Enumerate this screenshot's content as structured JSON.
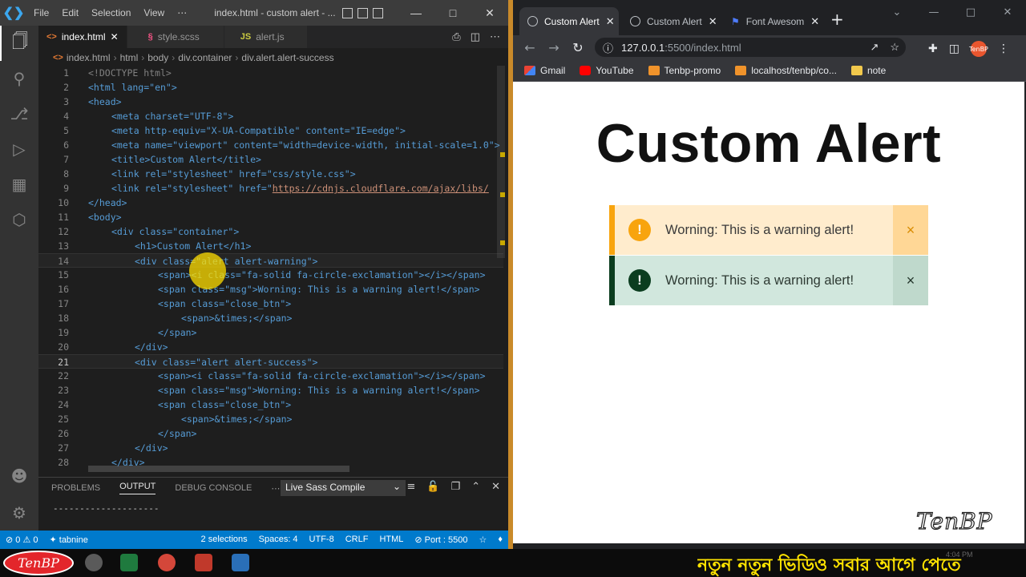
{
  "vscode": {
    "menu": [
      "File",
      "Edit",
      "Selection",
      "View",
      "⋯"
    ],
    "title": "index.html - custom alert - ...",
    "window_controls": [
      "—",
      "□",
      "✕"
    ],
    "tabs": [
      {
        "label": "index.html",
        "icon": "<>",
        "close": "✕"
      },
      {
        "label": "style.scss",
        "icon": "§"
      },
      {
        "label": "alert.js",
        "icon": "JS"
      }
    ],
    "breadcrumb": [
      "index.html",
      "html",
      "body",
      "div.container",
      "div.alert.alert-success"
    ],
    "line_numbers": [
      "1",
      "2",
      "3",
      "4",
      "5",
      "6",
      "7",
      "8",
      "9",
      "10",
      "11",
      "12",
      "13",
      "14",
      "15",
      "16",
      "17",
      "18",
      "19",
      "20",
      "21",
      "22",
      "23",
      "24",
      "25",
      "26",
      "27",
      "28"
    ],
    "code": {
      "l1": "<!DOCTYPE html>",
      "l2": "<html lang=\"en\">",
      "l3": "<head>",
      "l4": "<meta charset=\"UTF-8\">",
      "l5": "<meta http-equiv=\"X-UA-Compatible\" content=\"IE=edge\">",
      "l6": "<meta name=\"viewport\" content=\"width=device-width, initial-scale=1.0\">",
      "l7": "<title>Custom Alert</title>",
      "l8": "<link rel=\"stylesheet\" href=\"css/style.css\">",
      "l9a": "<link rel=\"stylesheet\" href=\"",
      "l9b": "https://cdnjs.cloudflare.com/ajax/libs/",
      "l10": "</head>",
      "l11": "<body>",
      "l12": "<div class=\"container\">",
      "l13": "<h1>Custom Alert</h1>",
      "l14": "<div class=\"alert alert-warning\">",
      "l15": "<span><i class=\"fa-solid fa-circle-exclamation\"></i></span>",
      "l16": "<span class=\"msg\">Worning: This is a warning alert!</span>",
      "l17": "<span class=\"close_btn\">",
      "l18": "<span>&times;</span>",
      "l19": "</span>",
      "l20": "</div>",
      "l21": "<div class=\"alert alert-success\">",
      "l22": "<span><i class=\"fa-solid fa-circle-exclamation\"></i></span>",
      "l23": "<span class=\"msg\">Worning: This is a warning alert!</span>",
      "l24": "<span class=\"close_btn\">",
      "l25": "<span>&times;</span>",
      "l26": "</span>",
      "l27": "</div>",
      "l28": "</div>"
    },
    "panel": {
      "tabs": [
        "PROBLEMS",
        "OUTPUT",
        "DEBUG CONSOLE",
        "⋯"
      ],
      "active_tab": "OUTPUT",
      "channel": "Live Sass Compile",
      "output_text": "--------------------"
    },
    "status": {
      "errors": "⊘ 0 ⚠ 0",
      "tabnine": "✦ tabnine",
      "selections": "2 selections",
      "spaces": "Spaces: 4",
      "encoding": "UTF-8",
      "eol": "CRLF",
      "language": "HTML",
      "port": "⊘ Port : 5500"
    }
  },
  "chrome": {
    "tabs": [
      {
        "label": "Custom Alert",
        "close": "✕"
      },
      {
        "label": "Custom Alert",
        "close": "✕"
      },
      {
        "label": "Font Awesom",
        "close": "✕"
      }
    ],
    "new_tab": "+",
    "url_host": "127.0.0.1",
    "url_path": ":5500/index.html",
    "bookmarks": [
      "Gmail",
      "YouTube",
      "Tenbp-promo",
      "localhost/tenbp/co...",
      "note"
    ],
    "avatar": "TenBP"
  },
  "page": {
    "heading": "Custom Alert",
    "alerts": [
      {
        "type": "warning",
        "icon": "!",
        "message": "Worning: This is a warning alert!",
        "close": "×"
      },
      {
        "type": "success",
        "icon": "!",
        "message": "Worning: This is a warning alert!",
        "close": "×"
      }
    ],
    "watermark": "TenBP"
  },
  "taskbar": {
    "logo": "TenBP",
    "ticker": "নতুন নতুন ভিডিও সবার আগে পেতে",
    "time": "4:04 PM"
  },
  "colors": {
    "vscode_status": "#007acc",
    "warning_border": "#f8a40e",
    "warning_bg": "#ffeccd",
    "success_border": "#0b3d1f",
    "success_bg": "#d1e7dd",
    "ticker": "#ffe400"
  }
}
